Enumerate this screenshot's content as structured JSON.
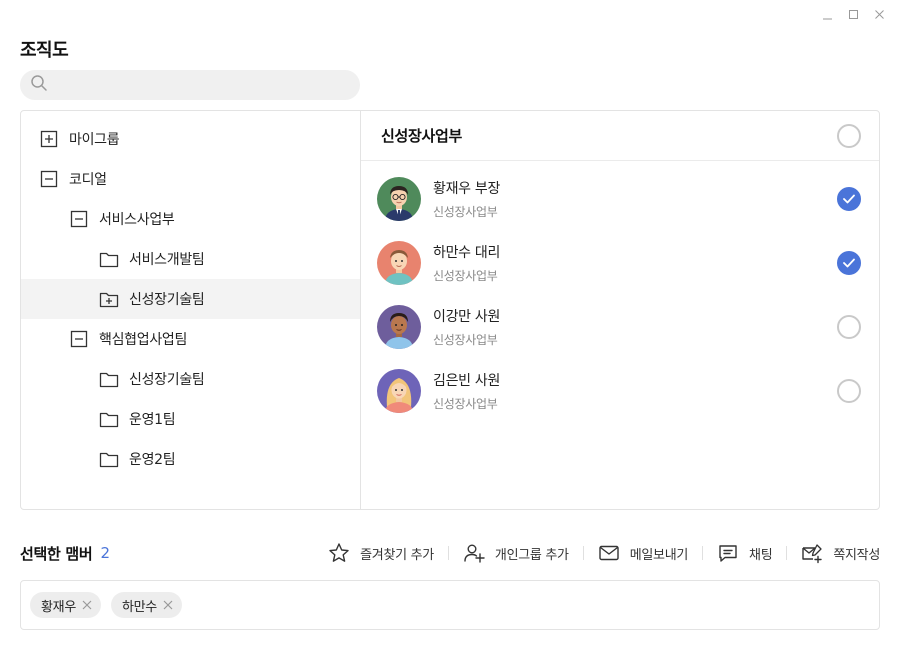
{
  "window": {
    "minimize_icon": "minimize-icon",
    "maximize_icon": "maximize-icon",
    "close_icon": "close-icon"
  },
  "title": "조직도",
  "search": {
    "placeholder": "",
    "value": ""
  },
  "tree": [
    {
      "label": "마이그룹",
      "icon": "plus-box-icon",
      "level": 0
    },
    {
      "label": "코디얼",
      "icon": "minus-box-icon",
      "level": 0
    },
    {
      "label": "서비스사업부",
      "icon": "minus-box-icon",
      "level": 1
    },
    {
      "label": "서비스개발팀",
      "icon": "folder-icon",
      "level": 2
    },
    {
      "label": "신성장기술팀",
      "icon": "folder-plus-icon",
      "level": 2,
      "selected": true
    },
    {
      "label": "핵심협업사업팀",
      "icon": "minus-box-icon",
      "level": 1
    },
    {
      "label": "신성장기술팀",
      "icon": "folder-icon",
      "level": 2
    },
    {
      "label": "운영1팀",
      "icon": "folder-icon",
      "level": 2
    },
    {
      "label": "운영2팀",
      "icon": "folder-icon",
      "level": 2
    }
  ],
  "members_panel": {
    "title": "신성장사업부",
    "members": [
      {
        "name": "황재우 부장",
        "dept": "신성장사업부",
        "checked": true,
        "avatar_bg": "#4f8a5b"
      },
      {
        "name": "하만수 대리",
        "dept": "신성장사업부",
        "checked": true,
        "avatar_bg": "#e8836e"
      },
      {
        "name": "이강만 사원",
        "dept": "신성장사업부",
        "checked": false,
        "avatar_bg": "#6e5e9c"
      },
      {
        "name": "김은빈 사원",
        "dept": "신성장사업부",
        "checked": false,
        "avatar_bg": "#6e64b8"
      }
    ]
  },
  "selected": {
    "title": "선택한 맴버",
    "count": "2",
    "chips": [
      "황재우",
      "하만수"
    ]
  },
  "actions": [
    {
      "label": "즐겨찾기 추가",
      "icon": "star-icon"
    },
    {
      "label": "개인그룹 추가",
      "icon": "add-user-icon"
    },
    {
      "label": "메일보내기",
      "icon": "mail-icon"
    },
    {
      "label": "채팅",
      "icon": "chat-icon"
    },
    {
      "label": "쪽지작성",
      "icon": "note-icon"
    }
  ],
  "colors": {
    "accent": "#4a74d9",
    "border": "#e3e3e3",
    "selected_row": "#f3f3f3"
  }
}
